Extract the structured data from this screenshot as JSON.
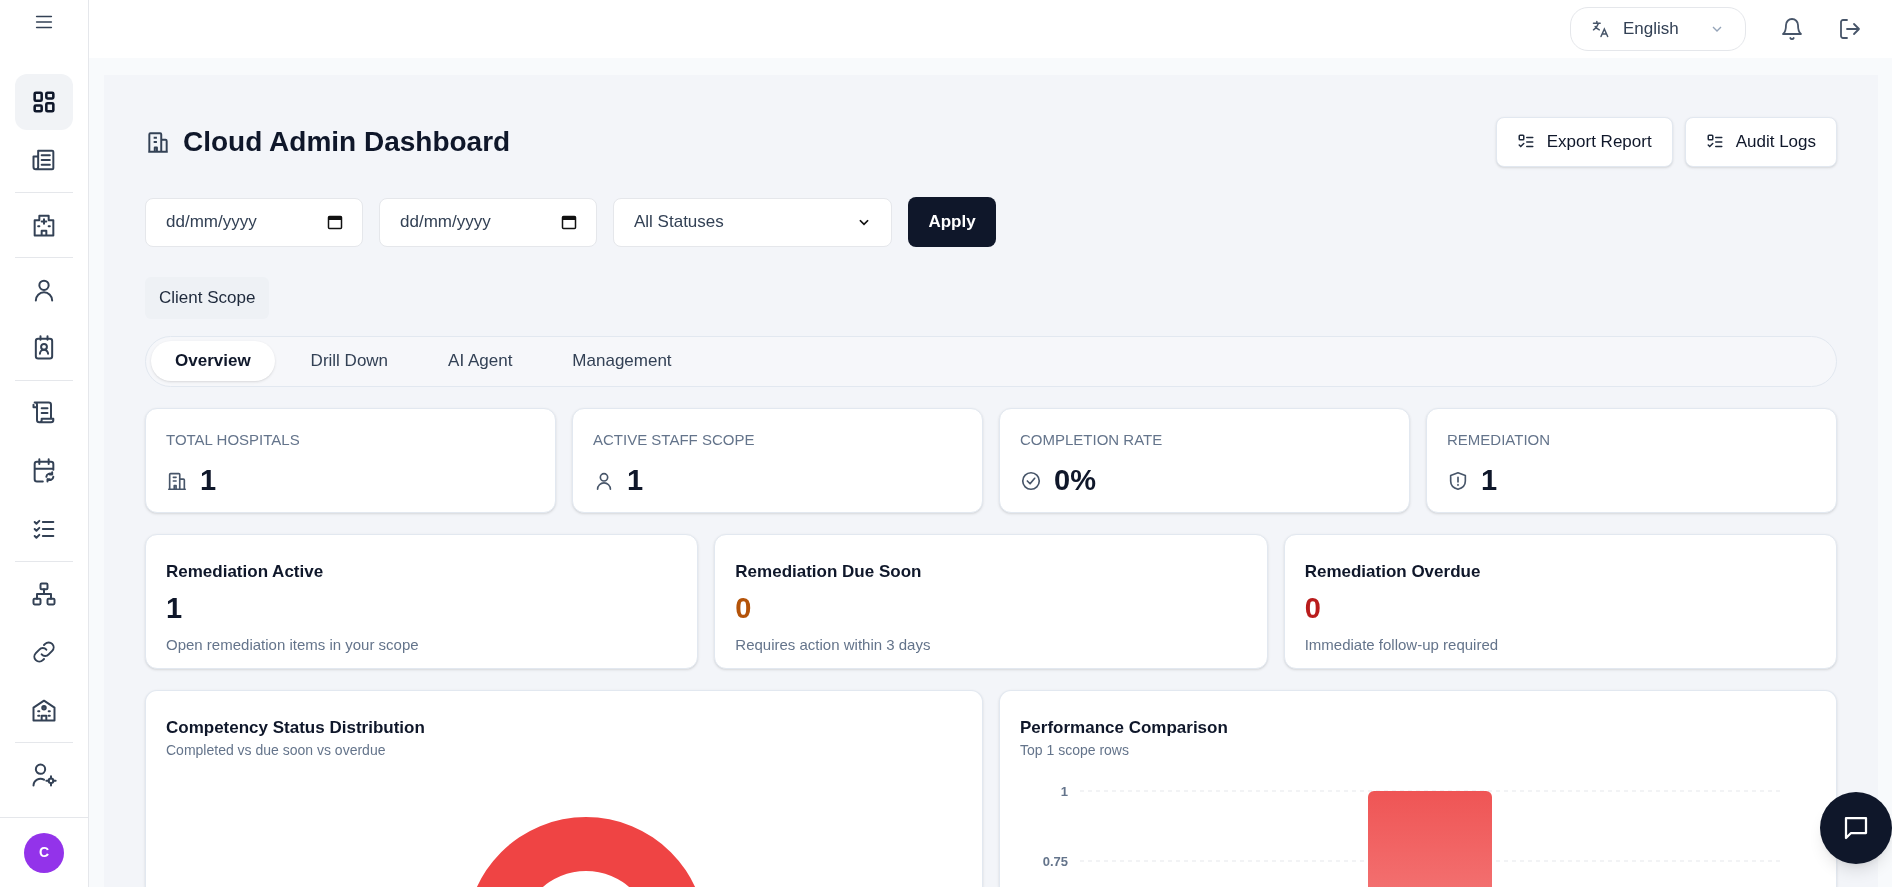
{
  "sidebar": {
    "groups": [
      {
        "items": [
          {
            "selected": true
          },
          {
            "selected": false
          }
        ]
      },
      {
        "items": [
          {
            "selected": false
          }
        ]
      },
      {
        "items": [
          {
            "selected": false
          },
          {
            "selected": false
          }
        ]
      },
      {
        "items": [
          {
            "selected": false
          },
          {
            "selected": false
          },
          {
            "selected": false
          }
        ]
      },
      {
        "items": [
          {
            "selected": false
          },
          {
            "selected": false
          },
          {
            "selected": false
          }
        ]
      },
      {
        "items": [
          {
            "selected": false
          }
        ]
      }
    ],
    "avatar": "C"
  },
  "header": {
    "language": "English"
  },
  "page": {
    "title": "Cloud Admin Dashboard",
    "actions": [
      "Export Report",
      "Audit Logs"
    ]
  },
  "filters": {
    "start_date": {
      "placeholder": "dd/mm/yyyy"
    },
    "end_date": {
      "placeholder": "dd/mm/yyyy"
    },
    "status": "All Statuses",
    "apply": "Apply"
  },
  "scope_badge": "Client Scope",
  "tabs": [
    {
      "label": "Overview",
      "selected": true
    },
    {
      "label": "Drill Down",
      "selected": false
    },
    {
      "label": "AI Agent",
      "selected": false
    },
    {
      "label": "Management",
      "selected": false
    }
  ],
  "stats": [
    {
      "kind": "building",
      "label": "TOTAL HOSPITALS",
      "value": "1"
    },
    {
      "kind": "person",
      "label": "ACTIVE STAFF SCOPE",
      "value": "1"
    },
    {
      "kind": "check",
      "label": "COMPLETION RATE",
      "value": "0%"
    },
    {
      "kind": "shield",
      "label": "REMEDIATION",
      "value": "1"
    }
  ],
  "remediation": [
    {
      "title": "Remediation Active",
      "value": "1",
      "color": "#0f172a",
      "note": "Open remediation items in your scope"
    },
    {
      "title": "Remediation Due Soon",
      "value": "0",
      "color": "#b45309",
      "note": "Requires action within 3 days"
    },
    {
      "title": "Remediation Overdue",
      "value": "0",
      "color": "#b91c1c",
      "note": "Immediate follow-up required"
    }
  ],
  "charts": [
    {
      "title": "Competency Status Distribution",
      "subtitle": "Completed vs due soon vs overdue"
    },
    {
      "title": "Performance Comparison",
      "subtitle": "Top 1 scope rows",
      "chart_data": {
        "type": "bar",
        "values": [
          1
        ],
        "ylim": [
          0,
          1
        ],
        "yticks": [
          {
            "value": 0.75,
            "label": "0.75"
          },
          {
            "value": 1,
            "label": "1"
          }
        ]
      }
    }
  ]
}
